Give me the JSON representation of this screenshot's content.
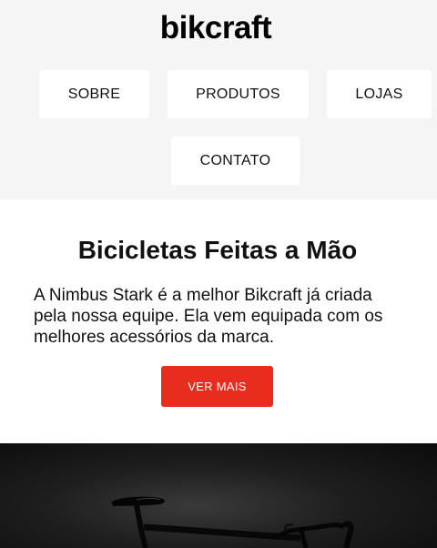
{
  "header": {
    "logo": "bikcraft",
    "nav": [
      {
        "label": "SOBRE"
      },
      {
        "label": "PRODUTOS"
      },
      {
        "label": "LOJAS"
      },
      {
        "label": "CONTATO"
      }
    ]
  },
  "hero": {
    "title": "Bicicletas Feitas a Mão",
    "text": "A Nimbus Stark é a melhor Bikcraft já criada pela nossa equipe. Ela vem equipada com os melhores acessórios da marca.",
    "cta_label": "VER MAIS"
  },
  "colors": {
    "accent": "#e82c1e",
    "header_bg": "#f5f5f5",
    "photo_bg": "#111111"
  },
  "media": {
    "hero_image": "bicycle-photo"
  }
}
